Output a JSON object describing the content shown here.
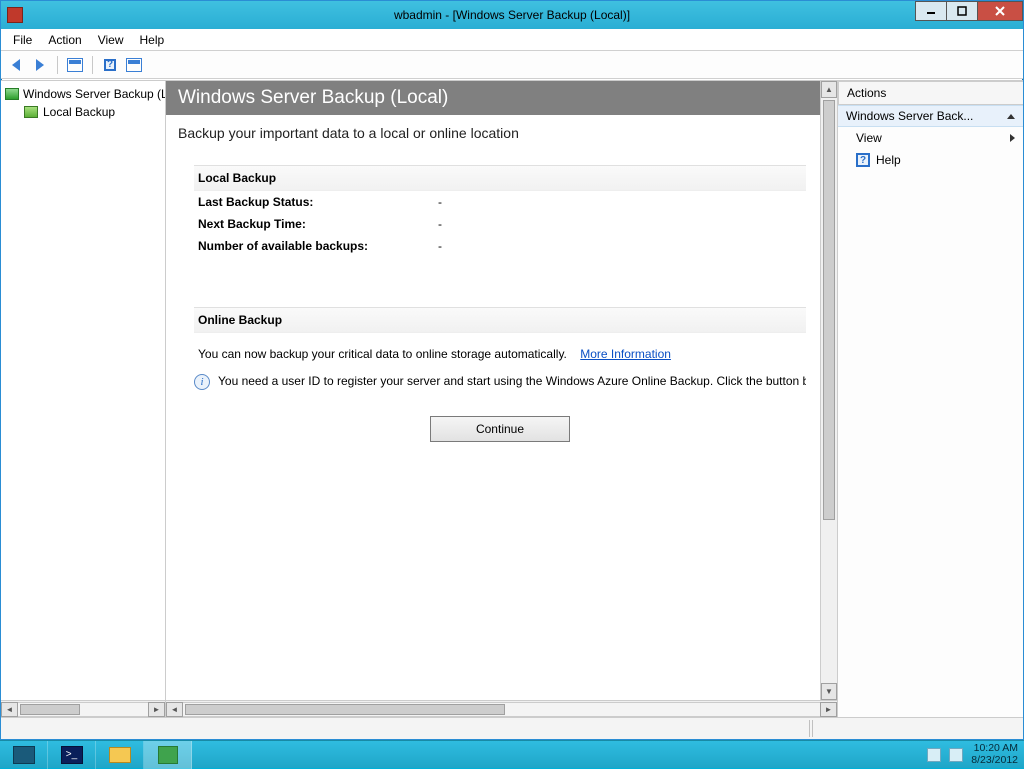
{
  "titlebar": {
    "title": "wbadmin - [Windows Server Backup (Local)]"
  },
  "menu": {
    "file": "File",
    "action": "Action",
    "view": "View",
    "help": "Help"
  },
  "tree": {
    "root": "Windows Server Backup (Local)",
    "child": "Local Backup"
  },
  "detail": {
    "header": "Windows Server Backup (Local)",
    "subtitle": "Backup your important data to a local or online location",
    "local": {
      "title": "Local Backup",
      "last_status_label": "Last Backup Status:",
      "last_status_value": "-",
      "next_time_label": "Next Backup Time:",
      "next_time_value": "-",
      "count_label": "Number of available backups:",
      "count_value": "-"
    },
    "online": {
      "title": "Online Backup",
      "blurb": "You can now backup your critical data to online storage automatically.",
      "more_info": "More Information",
      "info_row": "You need a user ID to register your server and start using the Windows Azure Online Backup. Click the button below to continue.",
      "continue": "Continue"
    }
  },
  "actions": {
    "header": "Actions",
    "group": "Windows Server Back...",
    "view": "View",
    "help": "Help"
  },
  "taskbar": {
    "time": "10:20 AM",
    "date": "8/23/2012"
  }
}
